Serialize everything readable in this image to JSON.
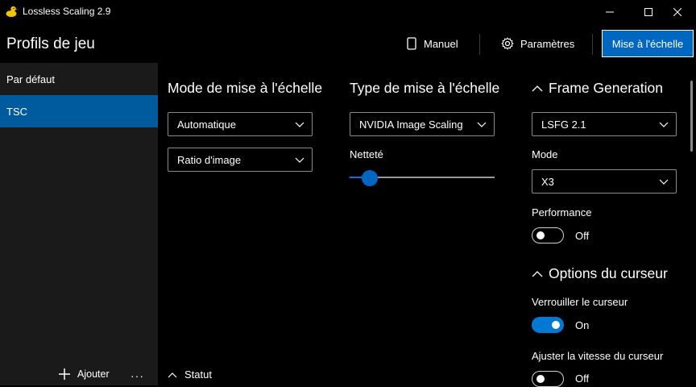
{
  "window": {
    "title": "Lossless Scaling 2.9",
    "accent": "#0067c0"
  },
  "header": {
    "title": "Profils de jeu",
    "manual_label": "Manuel",
    "settings_label": "Paramètres",
    "scale_button_label": "Mise à l'échelle"
  },
  "sidebar": {
    "items": [
      {
        "label": "Par défaut",
        "selected": false
      },
      {
        "label": "TSC",
        "selected": true
      }
    ],
    "add_label": "Ajouter",
    "more_label": "···"
  },
  "scaling_mode": {
    "title": "Mode de mise à l'échelle",
    "mode_value": "Automatique",
    "ratio_value": "Ratio d'image"
  },
  "scaling_type": {
    "title": "Type de mise à l'échelle",
    "type_value": "NVIDIA Image Scaling",
    "sharpness_label": "Netteté",
    "sharpness_level": 0.14
  },
  "frame_generation": {
    "title": "Frame Generation",
    "version_value": "LSFG 2.1",
    "mode_label": "Mode",
    "mode_value": "X3",
    "performance_label": "Performance",
    "performance_state": "Off"
  },
  "cursor_options": {
    "title": "Options du curseur",
    "lock_label": "Verrouiller le curseur",
    "lock_state": "On",
    "speed_label": "Ajuster la vitesse du curseur",
    "speed_state": "Off"
  },
  "status": {
    "title": "Statut"
  }
}
